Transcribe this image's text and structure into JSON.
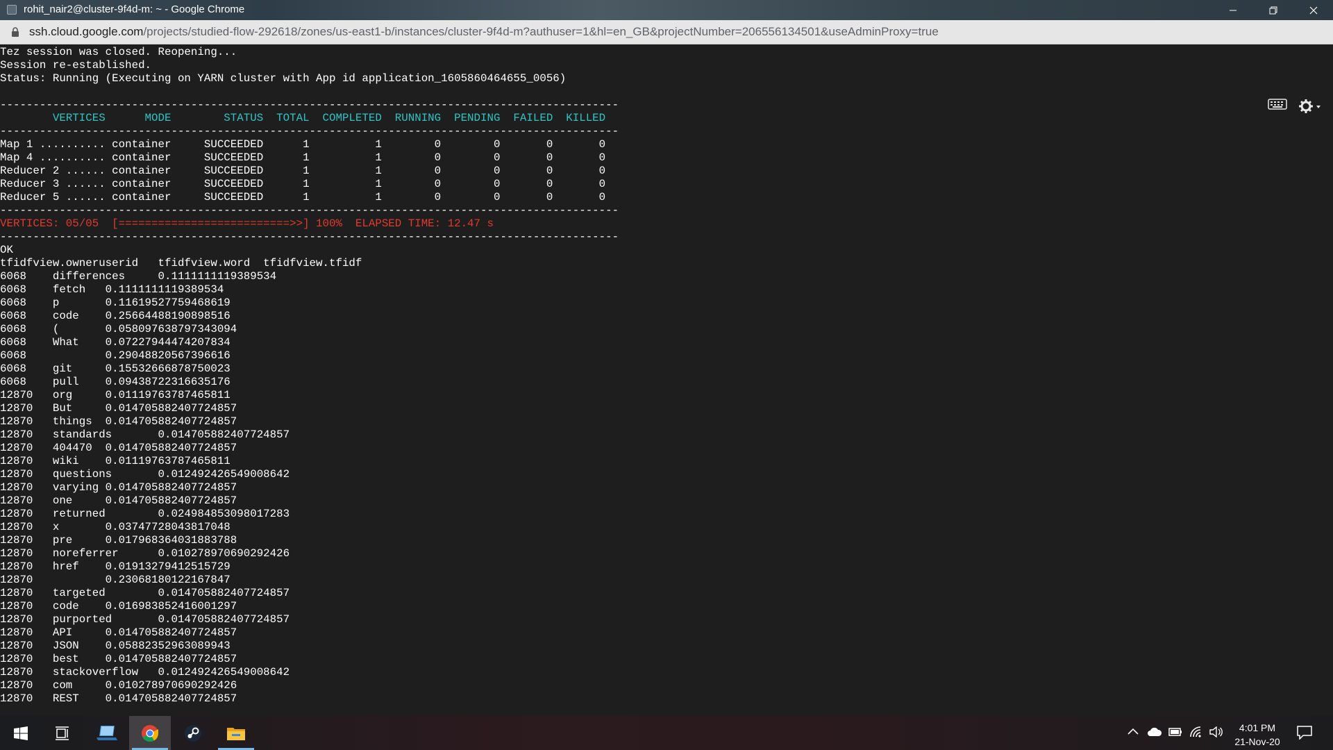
{
  "window": {
    "title": "rohit_nair2@cluster-9f4d-m: ~ - Google Chrome",
    "minimize_icon": "minimize-icon",
    "restore_icon": "restore-icon",
    "close_icon": "close-icon"
  },
  "address_bar": {
    "host": "ssh.cloud.google.com",
    "path": "/projects/studied-flow-292618/zones/us-east1-b/instances/cluster-9f4d-m?authuser=1&hl=en_GB&projectNumber=206556134501&useAdminProxy=true"
  },
  "terminal": {
    "toolbar": {
      "keyboard_icon": "keyboard-icon",
      "settings_icon": "gear-icon"
    },
    "colors": {
      "header": "#2ec4c4",
      "progress": "#e03b2e",
      "text": "#ffffff",
      "background": "#1e1e1e"
    },
    "lines": [
      {
        "text": "Tez session was closed. Reopening...",
        "style": "normal"
      },
      {
        "text": "Session re-established.",
        "style": "normal"
      },
      {
        "text": "Status: Running (Executing on YARN cluster with App id application_1605860464655_0056)",
        "style": "normal"
      },
      {
        "text": "",
        "style": "normal"
      },
      {
        "text": "----------------------------------------------------------------------------------------------",
        "style": "normal"
      },
      {
        "text": "        VERTICES      MODE        STATUS  TOTAL  COMPLETED  RUNNING  PENDING  FAILED  KILLED",
        "style": "cyan"
      },
      {
        "text": "----------------------------------------------------------------------------------------------",
        "style": "normal"
      },
      {
        "text": "Map 1 .......... container     SUCCEEDED      1          1        0        0       0       0",
        "style": "normal"
      },
      {
        "text": "Map 4 .......... container     SUCCEEDED      1          1        0        0       0       0",
        "style": "normal"
      },
      {
        "text": "Reducer 2 ...... container     SUCCEEDED      1          1        0        0       0       0",
        "style": "normal"
      },
      {
        "text": "Reducer 3 ...... container     SUCCEEDED      1          1        0        0       0       0",
        "style": "normal"
      },
      {
        "text": "Reducer 5 ...... container     SUCCEEDED      1          1        0        0       0       0",
        "style": "normal"
      },
      {
        "text": "----------------------------------------------------------------------------------------------",
        "style": "normal"
      },
      {
        "text": "VERTICES: 05/05  [==========================>>] 100%  ELAPSED TIME: 12.47 s",
        "style": "red"
      },
      {
        "text": "----------------------------------------------------------------------------------------------",
        "style": "normal"
      },
      {
        "text": "OK",
        "style": "normal"
      },
      {
        "text": "tfidfview.owneruserid   tfidfview.word  tfidfview.tfidf",
        "style": "normal"
      },
      {
        "text": "6068    differences     0.1111111119389534",
        "style": "normal"
      },
      {
        "text": "6068    fetch   0.1111111119389534",
        "style": "normal"
      },
      {
        "text": "6068    p       0.11619527759468619",
        "style": "normal"
      },
      {
        "text": "6068    code    0.25664488190898516",
        "style": "normal"
      },
      {
        "text": "6068    (       0.058097638797343094",
        "style": "normal"
      },
      {
        "text": "6068    What    0.07227944474207834",
        "style": "normal"
      },
      {
        "text": "6068            0.29048820567396616",
        "style": "normal"
      },
      {
        "text": "6068    git     0.15532666878750023",
        "style": "normal"
      },
      {
        "text": "6068    pull    0.09438722316635176",
        "style": "normal"
      },
      {
        "text": "12870   org     0.01119763787465811",
        "style": "normal"
      },
      {
        "text": "12870   But     0.014705882407724857",
        "style": "normal"
      },
      {
        "text": "12870   things  0.014705882407724857",
        "style": "normal"
      },
      {
        "text": "12870   standards       0.014705882407724857",
        "style": "normal"
      },
      {
        "text": "12870   404470  0.014705882407724857",
        "style": "normal"
      },
      {
        "text": "12870   wiki    0.01119763787465811",
        "style": "normal"
      },
      {
        "text": "12870   questions       0.012492426549008642",
        "style": "normal"
      },
      {
        "text": "12870   varying 0.014705882407724857",
        "style": "normal"
      },
      {
        "text": "12870   one     0.014705882407724857",
        "style": "normal"
      },
      {
        "text": "12870   returned        0.024984853098017283",
        "style": "normal"
      },
      {
        "text": "12870   x       0.03747728043817048",
        "style": "normal"
      },
      {
        "text": "12870   pre     0.017968364031883788",
        "style": "normal"
      },
      {
        "text": "12870   noreferrer      0.010278970690292426",
        "style": "normal"
      },
      {
        "text": "12870   href    0.01913279412515729",
        "style": "normal"
      },
      {
        "text": "12870           0.23068180122167847",
        "style": "normal"
      },
      {
        "text": "12870   targeted        0.014705882407724857",
        "style": "normal"
      },
      {
        "text": "12870   code    0.016983852416001297",
        "style": "normal"
      },
      {
        "text": "12870   purported       0.014705882407724857",
        "style": "normal"
      },
      {
        "text": "12870   API     0.014705882407724857",
        "style": "normal"
      },
      {
        "text": "12870   JSON    0.05882352963089943",
        "style": "normal"
      },
      {
        "text": "12870   best    0.014705882407724857",
        "style": "normal"
      },
      {
        "text": "12870   stackoverflow   0.012492426549008642",
        "style": "normal"
      },
      {
        "text": "12870   com     0.010278970690292426",
        "style": "normal"
      },
      {
        "text": "12870   REST    0.014705882407724857",
        "style": "normal"
      }
    ]
  },
  "taskbar": {
    "apps": [
      {
        "name": "start-button",
        "icon": "windows-icon"
      },
      {
        "name": "task-view-button",
        "icon": "task-view-icon"
      },
      {
        "name": "taskbar-app-laptop",
        "icon": "laptop-icon"
      },
      {
        "name": "taskbar-app-chrome",
        "icon": "chrome-icon"
      },
      {
        "name": "taskbar-app-steam",
        "icon": "steam-icon"
      },
      {
        "name": "taskbar-app-explorer",
        "icon": "folder-icon"
      }
    ],
    "tray": [
      "chevron-up-icon",
      "onedrive-icon",
      "battery-icon",
      "wifi-icon",
      "volume-icon"
    ],
    "time": "4:01 PM",
    "date": "21-Nov-20",
    "notification_icon": "notification-icon"
  }
}
